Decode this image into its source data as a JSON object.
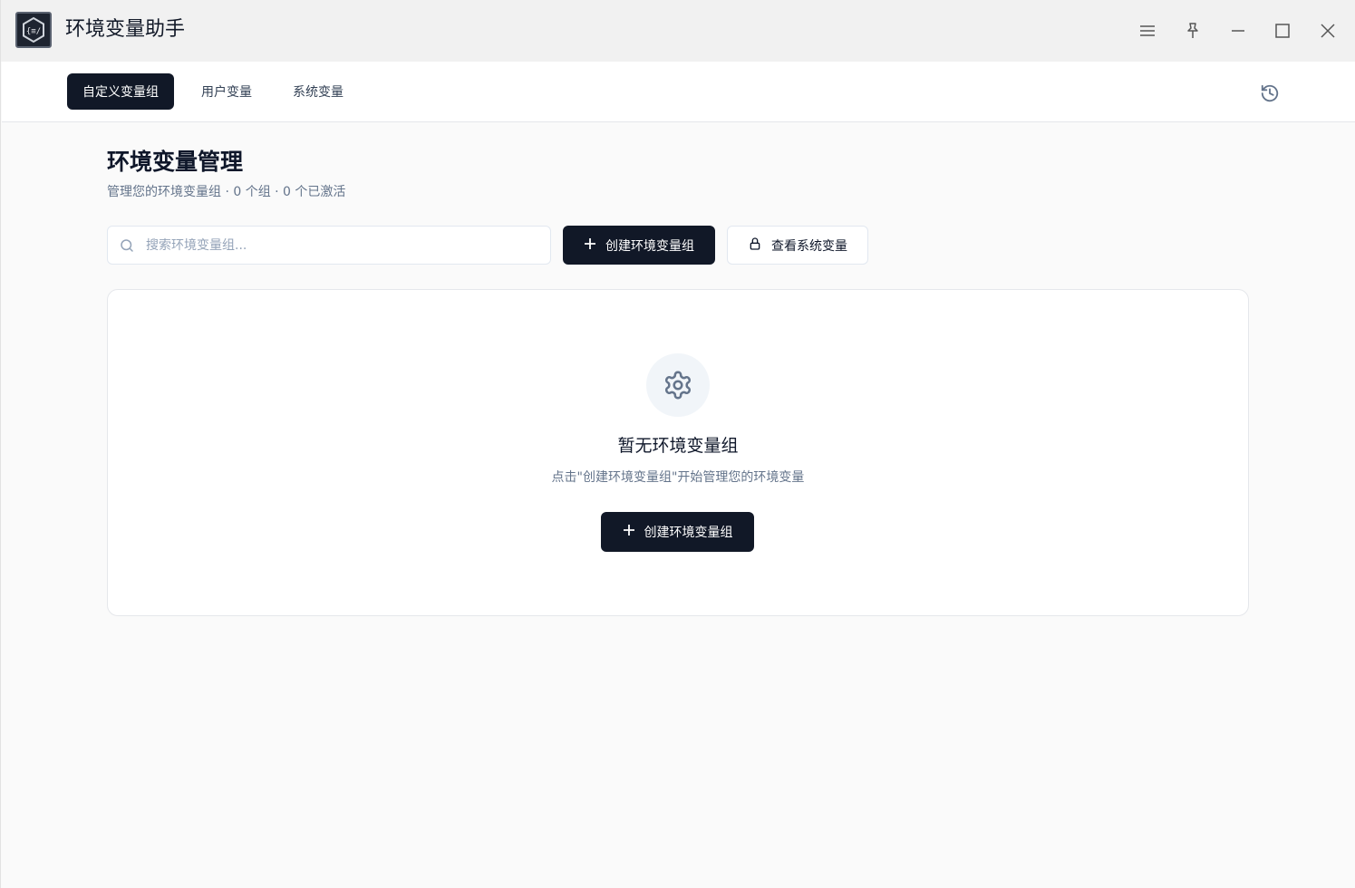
{
  "app": {
    "title": "环境变量助手",
    "logo_icon": "code-hexagon-icon"
  },
  "window_controls": {
    "menu_icon": "menu-icon",
    "pin_icon": "pin-icon",
    "minimize_icon": "minimize-icon",
    "maximize_icon": "maximize-icon",
    "close_icon": "close-icon"
  },
  "tabs": [
    {
      "label": "自定义变量组",
      "active": true
    },
    {
      "label": "用户变量",
      "active": false
    },
    {
      "label": "系统变量",
      "active": false
    }
  ],
  "header": {
    "history_icon": "history-icon"
  },
  "main": {
    "title": "环境变量管理",
    "subtitle": "管理您的环境变量组 · 0 个组 · 0 个已激活",
    "search": {
      "placeholder": "搜索环境变量组...",
      "value": ""
    },
    "create_button_label": "创建环境变量组",
    "view_system_button_label": "查看系统变量"
  },
  "empty_state": {
    "icon": "gear-icon",
    "title": "暂无环境变量组",
    "description": "点击\"创建环境变量组\"开始管理您的环境变量",
    "button_label": "创建环境变量组"
  },
  "colors": {
    "primary": "#111827",
    "muted_text": "#64748b",
    "border": "#e2e8f0",
    "background": "#fafafa"
  }
}
